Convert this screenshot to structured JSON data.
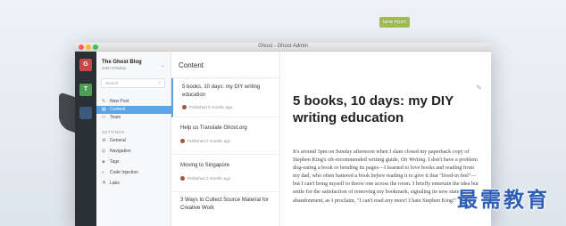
{
  "window": {
    "title": "Ghost - Ghost Admin"
  },
  "rail": {
    "blogs": [
      {
        "initial": "G"
      },
      {
        "initial": "T"
      },
      {
        "initial": ""
      }
    ]
  },
  "sidebar": {
    "blog_title": "The Ghost Blog",
    "blog_user": "John O'Nolan",
    "search_placeholder": "Search",
    "items": [
      {
        "label": "New Post",
        "icon": "pencil-icon"
      },
      {
        "label": "Content",
        "icon": "content-icon",
        "active": true
      },
      {
        "label": "Team",
        "icon": "team-icon"
      }
    ],
    "settings_label": "SETTINGS",
    "settings_items": [
      {
        "label": "General",
        "icon": "gear-icon"
      },
      {
        "label": "Navigation",
        "icon": "navigation-icon"
      },
      {
        "label": "Tags",
        "icon": "tag-icon"
      },
      {
        "label": "Code Injection",
        "icon": "code-icon"
      },
      {
        "label": "Labs",
        "icon": "labs-icon"
      }
    ]
  },
  "content": {
    "header": "Content",
    "posts": [
      {
        "title": "5 books, 10 days: my DIY writing education",
        "meta": "Published 2 months ago",
        "selected": true
      },
      {
        "title": "Help us Translate Ghost.org",
        "meta": "Published 2 months ago"
      },
      {
        "title": "Moving to Singapore",
        "meta": "Published 2 months ago"
      },
      {
        "title": "3 Ways to Collect Source Material for Creative Work",
        "meta": "Published 2 months ago"
      }
    ]
  },
  "editor": {
    "new_post_button": "NEW POST",
    "title": "5 books, 10 days: my DIY writing education",
    "body_1": "It's around 3pm on Sunday afternoon when I slam closed my paperback copy of Stephen King's oft-recommended writing guide, ",
    "body_em": "On Writing.",
    "body_2": " I don't have a problem dog-eating a book or bending its pages—I learned to love books and reading from my dad, who often battered a book ",
    "body_em2": "before",
    "body_3": " reading it to give it that \"lived-in feel\"—but I can't bring myself to throw one across the room. I briefly entertain the idea but settle for the satisfaction of removing my bookmark, signaling its new state of abandonment, as I proclaim, \"I can't read ",
    "body_em3": "any more",
    "body_4": "! I hate Stephen King!\""
  },
  "watermark": "最需教育",
  "colors": {
    "accent": "#5ba4e5",
    "new_post": "#9fbb58",
    "rail": "#2a3135"
  }
}
